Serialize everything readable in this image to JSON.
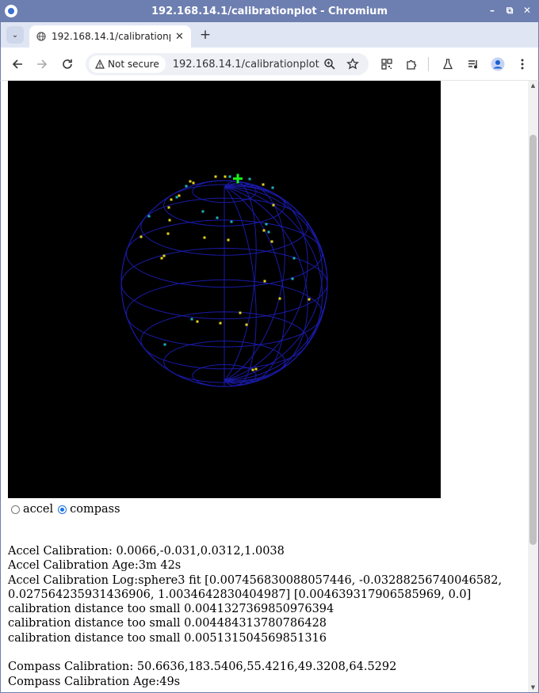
{
  "window": {
    "title": "192.168.14.1/calibrationplot - Chromium"
  },
  "tabs": [
    {
      "title": "192.168.14.1/calibrationplot",
      "active": true
    }
  ],
  "toolbar": {
    "security_label": "Not secure",
    "url": "192.168.14.1/calibrationplot"
  },
  "plot": {
    "background": "#000000",
    "mesh_color": "#1a1aa8",
    "points_yellow": "#e6d21a",
    "points_cyan": "#20b0c0",
    "marker_color": "#1aee1a"
  },
  "mode_select": {
    "options": [
      {
        "label": "accel",
        "selected": false
      },
      {
        "label": "compass",
        "selected": true
      }
    ]
  },
  "info": {
    "accel_calibration": "Accel Calibration: 0.0066,-0.031,0.0312,1.0038",
    "accel_age": "Accel Calibration Age:3m 42s",
    "accel_log": "Accel Calibration Log:sphere3 fit [0.007456830088057446, -0.03288256740046582, 0.027564235931436906, 1.0034642830404987] [0.004639317906585969, 0.0]",
    "log_lines": [
      "calibration distance too small 0.0041327369850976394",
      "calibration distance too small 0.004484313780786428",
      "calibration distance too small 0.005131504569851316"
    ],
    "compass_calibration": "Compass Calibration: 50.6636,183.5406,55.4216,49.3208,64.5292",
    "compass_age": "Compass Calibration Age:49s"
  }
}
